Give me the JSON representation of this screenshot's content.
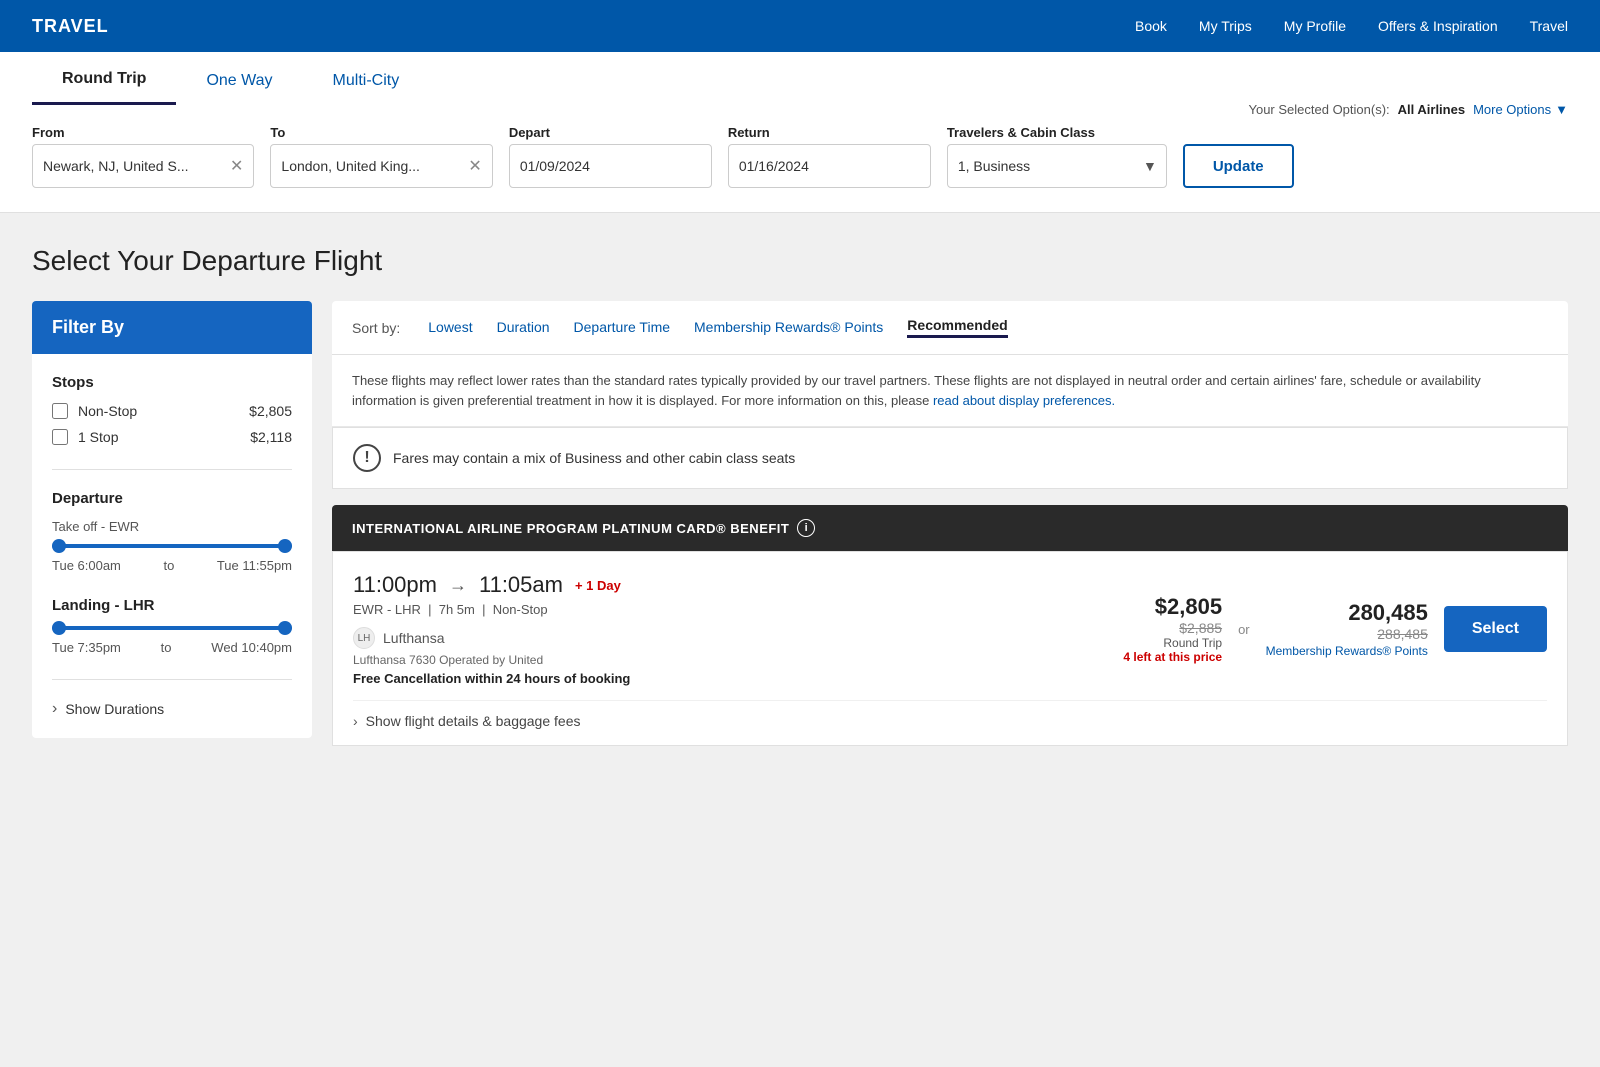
{
  "nav": {
    "brand": "TRAVEL",
    "links": [
      "Book",
      "My Trips",
      "My Profile",
      "Offers & Inspiration",
      "Travel"
    ]
  },
  "search": {
    "tabs": [
      {
        "id": "round-trip",
        "label": "Round Trip",
        "active": true
      },
      {
        "id": "one-way",
        "label": "One Way",
        "active": false
      },
      {
        "id": "multi-city",
        "label": "Multi-City",
        "active": false
      }
    ],
    "selected_options_label": "Your Selected Option(s):",
    "selected_options_value": "All Airlines",
    "more_options_label": "More Options",
    "from_label": "From",
    "from_value": "Newark, NJ, United S...",
    "to_label": "To",
    "to_value": "London, United King...",
    "depart_label": "Depart",
    "depart_value": "01/09/2024",
    "return_label": "Return",
    "return_value": "01/16/2024",
    "travelers_label": "Travelers & Cabin Class",
    "travelers_value": "1, Business",
    "update_label": "Update"
  },
  "main": {
    "section_title": "Select Your Departure Flight"
  },
  "filter": {
    "header": "Filter By",
    "stops_title": "Stops",
    "stops": [
      {
        "label": "Non-Stop",
        "price": "$2,805"
      },
      {
        "label": "1 Stop",
        "price": "$2,118"
      }
    ],
    "departure_title": "Departure",
    "departure_sub": "Take off - EWR",
    "departure_range_start": "Tue 6:00am",
    "departure_range_end": "Tue 11:55pm",
    "departure_to": "to",
    "landing_title": "Landing - LHR",
    "landing_range_start": "Tue 7:35pm",
    "landing_range_end": "Wed 10:40pm",
    "landing_to": "to",
    "show_durations_label": "Show Durations"
  },
  "results": {
    "sort_label": "Sort by:",
    "sort_options": [
      {
        "label": "Lowest",
        "active": false
      },
      {
        "label": "Duration",
        "active": false
      },
      {
        "label": "Departure Time",
        "active": false
      },
      {
        "label": "Membership Rewards® Points",
        "active": false
      },
      {
        "label": "Recommended",
        "active": true
      }
    ],
    "disclaimer": "These flights may reflect lower rates than the standard rates typically provided by our travel partners. These flights are not displayed in neutral order and certain airlines' fare, schedule or availability information is given preferential treatment in how it is displayed. For more information on this, please",
    "disclaimer_link": "read about display preferences.",
    "info_text": "Fares may contain a mix of Business and other cabin class seats",
    "iap_banner": "INTERNATIONAL AIRLINE PROGRAM PLATINUM CARD® BENEFIT",
    "flight": {
      "depart_time": "11:00pm",
      "arrive_time": "11:05am",
      "day_change": "+ 1 Day",
      "route": "EWR - LHR",
      "duration": "7h 5m",
      "stops": "Non-Stop",
      "airline_name": "Lufthansa",
      "operated_by": "Lufthansa 7630 Operated by United",
      "free_cancel": "Free Cancellation within 24 hours of booking",
      "price_current": "$2,805",
      "price_original": "$2,885",
      "price_type": "Round Trip",
      "price_urgency": "4 left at this price",
      "or": "or",
      "points_current": "280,485",
      "points_original": "288,485",
      "points_link": "Membership Rewards® Points",
      "select_label": "Select",
      "show_details_label": "Show flight details & baggage fees"
    }
  }
}
